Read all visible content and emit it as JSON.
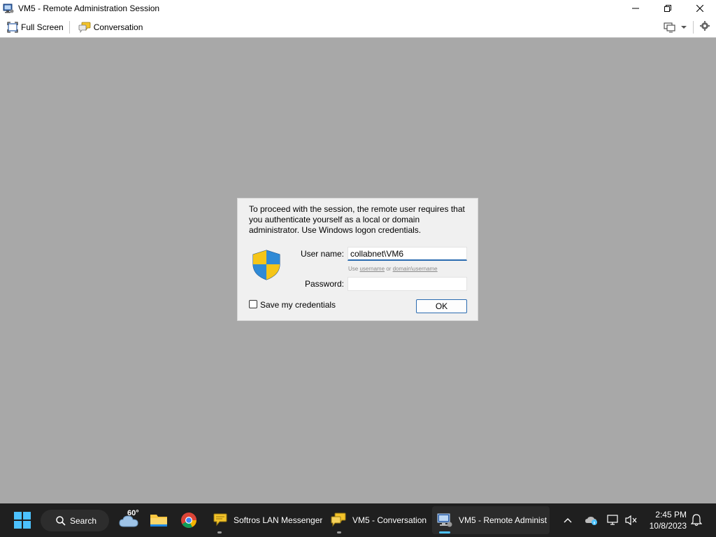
{
  "window": {
    "title": "VM5 - Remote Administration Session"
  },
  "toolbar": {
    "full_screen_label": "Full Screen",
    "conversation_label": "Conversation"
  },
  "dialog": {
    "message": "To proceed with the session, the remote user requires that you authenticate yourself as a local or domain administrator. Use Windows logon credentials.",
    "username_label": "User name:",
    "username_value": "collabnet\\VM6",
    "hint_prefix": "Use ",
    "hint_username": "username",
    "hint_or": " or ",
    "hint_domain_username": "domain\\username",
    "password_label": "Password:",
    "password_value": "",
    "save_credentials_label": "Save my credentials",
    "save_credentials_checked": false,
    "ok_label": "OK"
  },
  "taskbar": {
    "search_label": "Search",
    "weather_temp": "60°",
    "apps": [
      {
        "name": "Softros LAN Messenger"
      },
      {
        "name": "VM5 - Conversation"
      },
      {
        "name": "VM5 - Remote Administ"
      }
    ],
    "time": "2:45 PM",
    "date": "10/8/2023"
  },
  "colors": {
    "accent": "#2a6bb0",
    "taskbar": "#1f1f1f",
    "workspace": "#a8a8a8",
    "dialog": "#f0f0f0"
  }
}
